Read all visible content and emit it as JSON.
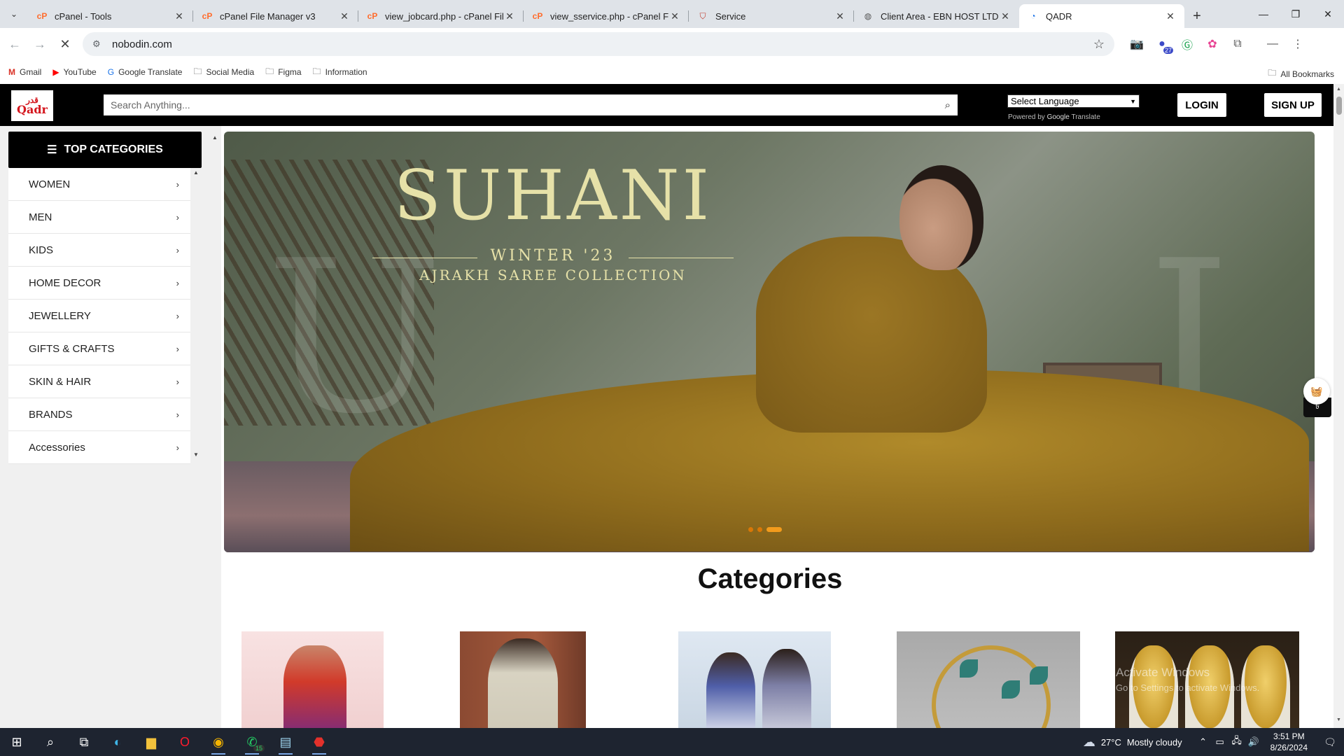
{
  "browser": {
    "tabs": [
      {
        "title": "cPanel - Tools",
        "favicon": "cpanel-icon"
      },
      {
        "title": "cPanel File Manager v3",
        "favicon": "cpanel-icon"
      },
      {
        "title": "view_jobcard.php - cPanel File",
        "favicon": "cpanel-icon"
      },
      {
        "title": "view_sservice.php - cPanel File",
        "favicon": "cpanel-icon"
      },
      {
        "title": "Service",
        "favicon": "shield-icon"
      },
      {
        "title": "Client Area - EBN HOST LTD",
        "favicon": "globe-icon"
      },
      {
        "title": "QADR",
        "favicon": "loading-icon",
        "active": true
      }
    ],
    "address": "nobodin.com",
    "bookmarks": [
      "Gmail",
      "YouTube",
      "Google Translate",
      "Social Media",
      "Figma",
      "Information"
    ],
    "all_bookmarks": "All Bookmarks",
    "extension_badge": "27"
  },
  "site": {
    "logo": {
      "arabic": "قدر",
      "latin": "Qadr"
    },
    "search_placeholder": "Search Anything...",
    "language_select": "Select Language",
    "powered_by": "Powered by",
    "google_word": "Google",
    "translate_word": "Translate",
    "login": "LOGIN",
    "signup": "SIGN UP",
    "top_categories": "TOP CATEGORIES",
    "categories_menu": [
      "WOMEN",
      "MEN",
      "KIDS",
      "HOME DECOR",
      "JEWELLERY",
      "GIFTS & CRAFTS",
      "SKIN & HAIR",
      "BRANDS",
      "Accessories"
    ],
    "hero": {
      "title": "SUHANI",
      "subtitle": "WINTER '23",
      "collection": "AJRAKH SAREE COLLECTION",
      "slide_count": 3,
      "active_slide": 3
    },
    "categories_heading": "Categories",
    "cart_count": "৳"
  },
  "watermark": {
    "line1": "Activate Windows",
    "line2": "Go to Settings to activate Windows."
  },
  "taskbar": {
    "weather_temp": "27°C",
    "weather_text": "Mostly cloudy",
    "time": "3:51 PM",
    "date": "8/26/2024",
    "whatsapp_badge": "15"
  }
}
